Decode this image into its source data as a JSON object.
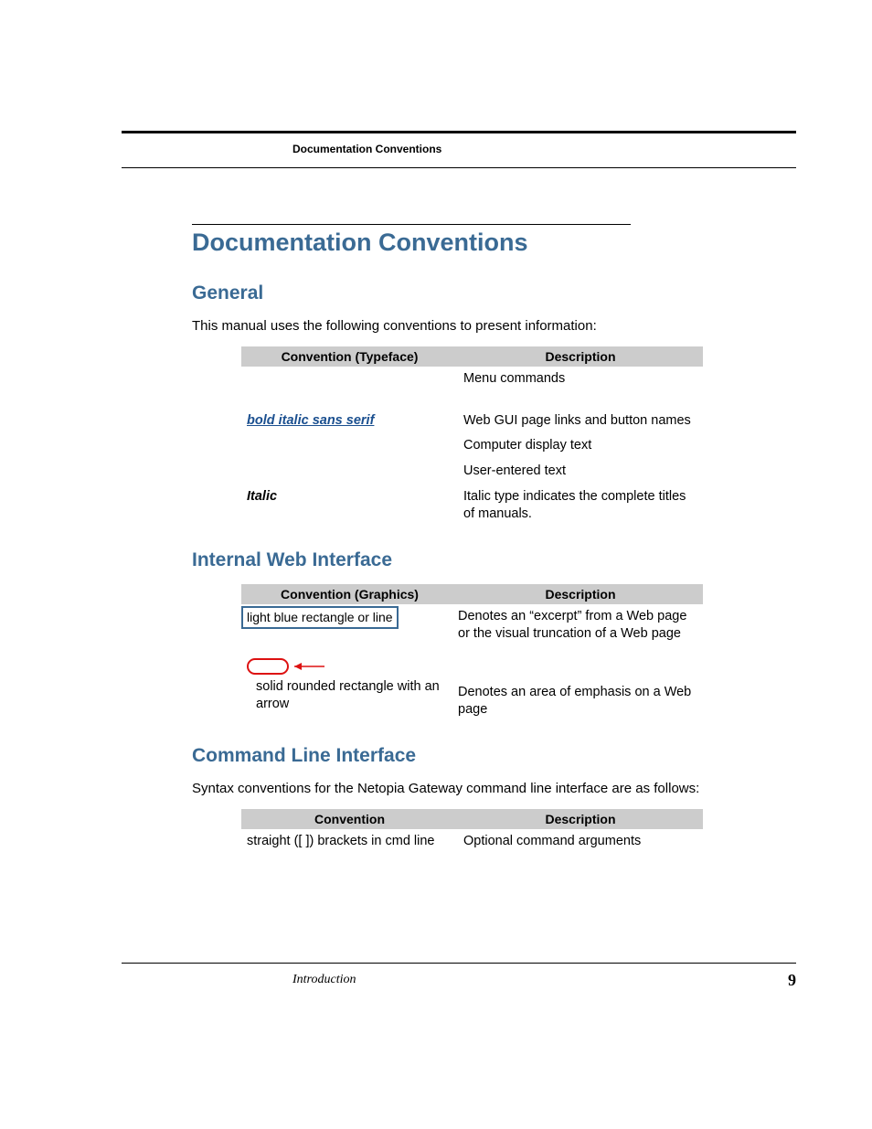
{
  "header": {
    "running_title": "Documentation Conventions"
  },
  "title": "Documentation Conventions",
  "sections": {
    "general": {
      "heading": "General",
      "intro": "This manual uses the following conventions to present information:",
      "table": {
        "header_left": "Convention (Typeface)",
        "header_right": "Description",
        "rows": {
          "r1_left": "",
          "r1_right": "Menu commands",
          "r2_left": "bold italic sans serif",
          "r2_right": "Web GUI page links and button names",
          "r3_right": "Computer display text",
          "r4_right": "User-entered text",
          "r5_left": "Italic",
          "r5_right": "Italic type indicates the complete titles of manuals."
        }
      }
    },
    "internal": {
      "heading": "Internal Web Interface",
      "table": {
        "header_left": "Convention (Graphics)",
        "header_right": "Description",
        "rows": {
          "r1_left": "light blue rectangle or line",
          "r1_right": "Denotes an “excerpt” from a Web page or the visual truncation of a Web page",
          "r2_left": "solid rounded rectangle with an arrow",
          "r2_right": "Denotes an area of emphasis on a Web page"
        }
      }
    },
    "cli": {
      "heading": "Command Line Interface",
      "intro": "Syntax conventions for the Netopia Gateway command line interface are as follows:",
      "table": {
        "header_left": "Convention",
        "header_right": "Description",
        "rows": {
          "r1_left": "straight ([ ]) brackets in cmd line",
          "r1_right": "Optional command arguments"
        }
      }
    }
  },
  "footer": {
    "chapter": "Introduction",
    "page_number": "9"
  }
}
